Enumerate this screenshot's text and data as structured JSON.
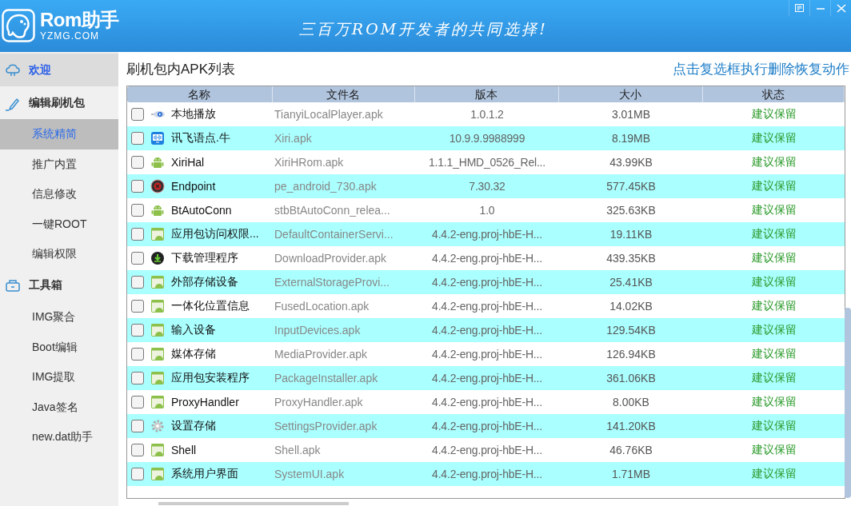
{
  "header": {
    "logo_title": "Rom助手",
    "logo_subtitle": "YZMG.COM",
    "slogan": "三百万ROM开发者的共同选择!"
  },
  "sidebar": [
    {
      "label": "欢迎",
      "kind": "cloud",
      "selected": true
    },
    {
      "label": "编辑刷机包",
      "kind": "pen",
      "selected": false,
      "children": [
        {
          "label": "系统精简",
          "selected": true
        },
        {
          "label": "推广内置",
          "selected": false
        },
        {
          "label": "信息修改",
          "selected": false
        },
        {
          "label": "一键ROOT",
          "selected": false
        },
        {
          "label": "编辑权限",
          "selected": false
        }
      ]
    },
    {
      "label": "工具箱",
      "kind": "box",
      "selected": false,
      "children": [
        {
          "label": "IMG聚合",
          "selected": false
        },
        {
          "label": "Boot编辑",
          "selected": false
        },
        {
          "label": "IMG提取",
          "selected": false
        },
        {
          "label": "Java签名",
          "selected": false
        },
        {
          "label": "new.dat助手",
          "selected": false
        }
      ]
    }
  ],
  "main": {
    "title": "刷机包内APK列表",
    "hint": "点击复选框执行删除恢复动作"
  },
  "table": {
    "columns": [
      "名称",
      "文件名",
      "版本",
      "大小",
      "状态"
    ],
    "rows": [
      {
        "kind": "player",
        "name": "本地播放",
        "file": "TianyiLocalPlayer.apk",
        "version": "1.0.1.2",
        "size": "3.01MB",
        "status": "建议保留",
        "checked": false
      },
      {
        "kind": "voice",
        "name": "讯飞语点.牛",
        "file": "Xiri.apk",
        "version": "10.9.9.9988999",
        "size": "8.19MB",
        "status": "建议保留",
        "checked": false
      },
      {
        "kind": "robot",
        "name": "XiriHal",
        "file": "XiriHRom.apk",
        "version": "1.1.1_HMD_0526_Rel...",
        "size": "43.99KB",
        "status": "建议保留",
        "checked": false
      },
      {
        "kind": "record",
        "name": "Endpoint",
        "file": "pe_android_730.apk",
        "version": "7.30.32",
        "size": "577.45KB",
        "status": "建议保留",
        "checked": false
      },
      {
        "kind": "robot",
        "name": "BtAutoConn",
        "file": "stbBtAutoConn_relea...",
        "version": "1.0",
        "size": "325.63KB",
        "status": "建议保留",
        "checked": false
      },
      {
        "kind": "app",
        "name": "应用包访问权限...",
        "file": "DefaultContainerServi...",
        "version": "4.4.2-eng.proj-hbE-H...",
        "size": "19.11KB",
        "status": "建议保留",
        "checked": false
      },
      {
        "kind": "download",
        "name": "下载管理程序",
        "file": "DownloadProvider.apk",
        "version": "4.4.2-eng.proj-hbE-H...",
        "size": "439.35KB",
        "status": "建议保留",
        "checked": false
      },
      {
        "kind": "app",
        "name": "外部存储设备",
        "file": "ExternalStorageProvi...",
        "version": "4.4.2-eng.proj-hbE-H...",
        "size": "25.41KB",
        "status": "建议保留",
        "checked": false
      },
      {
        "kind": "app",
        "name": "一体化位置信息",
        "file": "FusedLocation.apk",
        "version": "4.4.2-eng.proj-hbE-H...",
        "size": "14.02KB",
        "status": "建议保留",
        "checked": false
      },
      {
        "kind": "app",
        "name": "输入设备",
        "file": "InputDevices.apk",
        "version": "4.4.2-eng.proj-hbE-H...",
        "size": "129.54KB",
        "status": "建议保留",
        "checked": false
      },
      {
        "kind": "app",
        "name": "媒体存储",
        "file": "MediaProvider.apk",
        "version": "4.4.2-eng.proj-hbE-H...",
        "size": "126.94KB",
        "status": "建议保留",
        "checked": false
      },
      {
        "kind": "app",
        "name": "应用包安装程序",
        "file": "PackageInstaller.apk",
        "version": "4.4.2-eng.proj-hbE-H...",
        "size": "361.06KB",
        "status": "建议保留",
        "checked": false
      },
      {
        "kind": "app",
        "name": "ProxyHandler",
        "file": "ProxyHandler.apk",
        "version": "4.4.2-eng.proj-hbE-H...",
        "size": "8.00KB",
        "status": "建议保留",
        "checked": false
      },
      {
        "kind": "gear",
        "name": "设置存储",
        "file": "SettingsProvider.apk",
        "version": "4.4.2-eng.proj-hbE-H...",
        "size": "141.20KB",
        "status": "建议保留",
        "checked": false
      },
      {
        "kind": "app",
        "name": "Shell",
        "file": "Shell.apk",
        "version": "4.4.2-eng.proj-hbE-H...",
        "size": "46.76KB",
        "status": "建议保留",
        "checked": false
      },
      {
        "kind": "app",
        "name": "系统用户界面",
        "file": "SystemUI.apk",
        "version": "4.4.2-eng.proj-hbE-H...",
        "size": "1.71MB",
        "status": "建议保留",
        "checked": false
      }
    ]
  }
}
